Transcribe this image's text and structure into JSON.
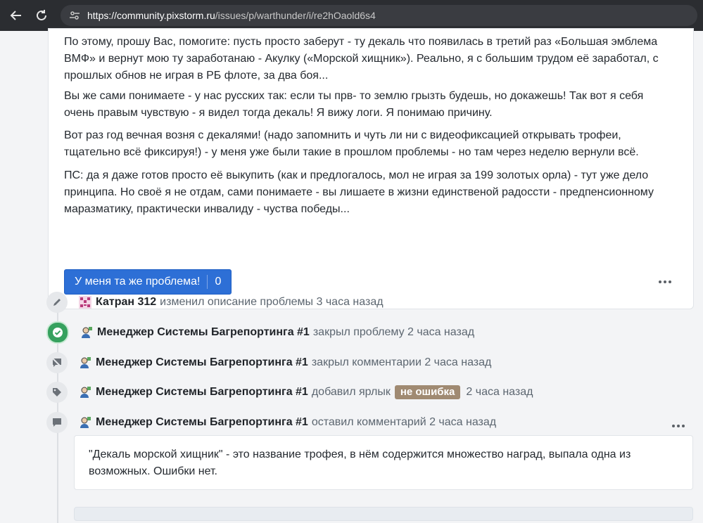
{
  "browser": {
    "url_host": "https://community.pixstorm.ru",
    "url_path": "/issues/p/warthunder/i/re2hOaold6s4"
  },
  "issue": {
    "paragraphs": [
      "По этому, прошу Вас, помогите: пусть просто заберут - ту декаль что появилась в третий раз «Большая эмблема ВМФ» и вернут мою ту заработанаю - Акулку («Морской хищник»). Реально, я с большим трудом её заработал, с прошлых обнов не играя в РБ флоте, за два боя...",
      "Вы же сами понимаете - у нас русских так: если ты прв- то землю грызть будешь, но докажешь! Так вот я себя очень правым чувствую - я видел тогда декаль! Я вижу логи. Я понимаю причину.",
      "Вот раз год вечная возня с декалями! (надо запомнить и чуть ли ни с видеофиксацией открывать трофеи, тщательно всё фиксируя!) - у меня уже были такие в прошлом проблемы - но там через неделю вернули всё.",
      "ПС: да я даже готов просто её выкупить (как и предлогалось, мол не играя за 199 золотых орла) - тут уже дело принципа. Но своё я не отдам, сами понимаете - вы лишаете в жизни единственой радосcти - предпенсионному маразматику, практически инвалиду - чуства победы..."
    ],
    "metoo_label": "У меня та же проблема!",
    "metoo_count": "0"
  },
  "timeline": [
    {
      "icon": "pencil-icon",
      "user": "Катран 312",
      "action": "изменил описание проблемы 3 часа назад"
    },
    {
      "icon": "check-circle-icon",
      "user": "Менеджер Системы Багрепортинга #1",
      "action": "закрыл проблему 2 часа назад"
    },
    {
      "icon": "comments-off-icon",
      "user": "Менеджер Системы Багрепортинга #1",
      "action": "закрыл комментарии 2 часа назад"
    },
    {
      "icon": "tag-icon",
      "user": "Менеджер Системы Багрепортинга #1",
      "action": "добавил ярлык",
      "label": "не ошибка",
      "time": "2 часа назад"
    },
    {
      "icon": "comment-icon",
      "user": "Менеджер Системы Багрепортинга #1",
      "action": "оставил комментарий 2 часа назад"
    }
  ],
  "comment": {
    "text": "\"Декаль морской хищник\" - это название трофея, в нём содержится множество наград, выпала одна из возможных. Ошибки нет."
  },
  "colors": {
    "primary_button": "#2d6fd6",
    "closed_green": "#36a15e",
    "label_chip": "#a08a72"
  }
}
